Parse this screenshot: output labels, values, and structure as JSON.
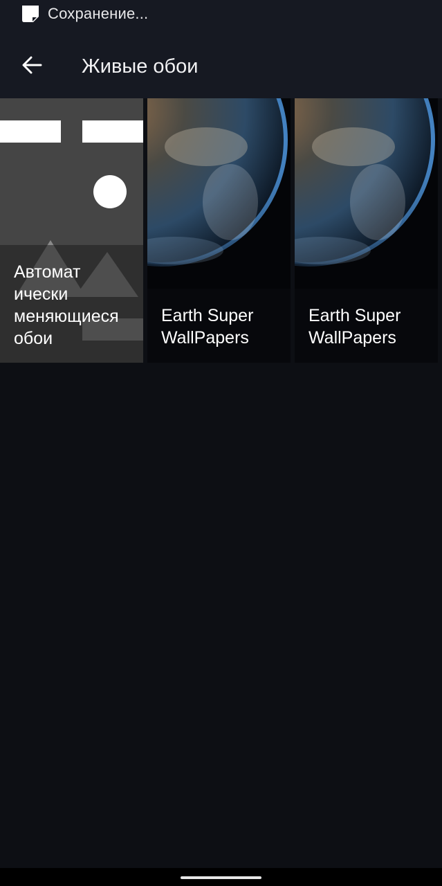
{
  "status_bar": {
    "notification_icon": "save-notification-icon",
    "text": "Сохранение..."
  },
  "app_bar": {
    "back_icon": "arrow-back-icon",
    "title": "Живые обои"
  },
  "wallpapers": [
    {
      "label": "Автомат\nически\nменяющиеся\nобои",
      "thumbnail": "abstract-shapes"
    },
    {
      "label": "Earth Super\nWallPapers",
      "thumbnail": "earth-from-space"
    },
    {
      "label": "Earth Super\nWallPapers",
      "thumbnail": "earth-from-space"
    }
  ],
  "colors": {
    "background": "#0d0f14",
    "bar": "#161922",
    "tile_gray": "#454545"
  }
}
